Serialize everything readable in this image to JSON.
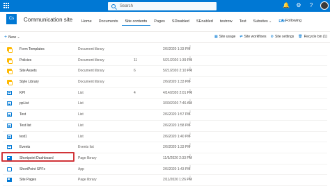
{
  "suitebar": {
    "search_placeholder": "Search",
    "icons": [
      "waffle-icon",
      "search-icon",
      "bell-icon",
      "gear-icon",
      "help-icon",
      "avatar"
    ]
  },
  "site": {
    "logo": "Cs",
    "title": "Communication site"
  },
  "nav": {
    "items": [
      "Home",
      "Documents",
      "Site contents",
      "Pages",
      "SDisabled",
      "SEnabled",
      "testrow",
      "Test",
      "Subsites"
    ],
    "edit": "Edit",
    "following": "Following"
  },
  "cmdbar": {
    "new": "New",
    "site_usage": "Site usage",
    "site_workflows": "Site workflows",
    "site_settings": "Site settings",
    "recycle_bin": "Recycle bin (1)"
  },
  "rows": [
    {
      "name": "Form Templates",
      "type": "Document library",
      "count": "",
      "modified": "2/6/2020 1:33 PM",
      "icon": "library-icon"
    },
    {
      "name": "Policies",
      "type": "Document library",
      "count": "11",
      "modified": "5/21/2020 1:39 PM",
      "icon": "library-icon"
    },
    {
      "name": "Site Assets",
      "type": "Document library",
      "count": "6",
      "modified": "5/21/2020 2:10 PM",
      "icon": "library-icon"
    },
    {
      "name": "Style Library",
      "type": "Document library",
      "count": "",
      "modified": "2/6/2020 1:33 PM",
      "icon": "library-icon"
    },
    {
      "name": "KPI",
      "type": "List",
      "count": "4",
      "modified": "4/14/2020 2:01 PM",
      "icon": "list-icon"
    },
    {
      "name": "ppList",
      "type": "List",
      "count": "",
      "modified": "3/30/2020 7:46 AM",
      "icon": "list-icon"
    },
    {
      "name": "Test",
      "type": "List",
      "count": "",
      "modified": "2/6/2020 1:57 PM",
      "icon": "list-icon"
    },
    {
      "name": "Test list",
      "type": "List",
      "count": "",
      "modified": "2/6/2020 1:58 PM",
      "icon": "list-icon"
    },
    {
      "name": "test1",
      "type": "List",
      "count": "",
      "modified": "2/6/2020 1:40 PM",
      "icon": "list-icon"
    },
    {
      "name": "Events",
      "type": "Events list",
      "count": "",
      "modified": "2/6/2020 1:33 PM",
      "icon": "events-icon"
    },
    {
      "name": "Shortpoint Dashboard",
      "type": "Page library",
      "count": "",
      "modified": "11/5/2020 2:33 PM",
      "icon": "page-library-icon"
    },
    {
      "name": "ShortPoint SPFx",
      "type": "App",
      "count": "",
      "modified": "2/6/2020 1:43 PM",
      "icon": "app-icon"
    },
    {
      "name": "Site Pages",
      "type": "Page library",
      "count": "",
      "modified": "2/11/2020 1:26 PM",
      "icon": "page-library-icon"
    }
  ]
}
